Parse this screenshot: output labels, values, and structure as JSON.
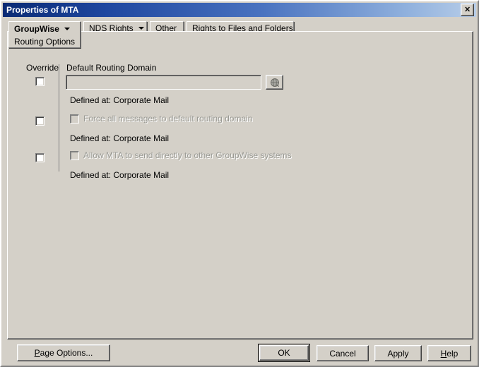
{
  "window": {
    "title": "Properties of MTA",
    "close_icon": "close-icon",
    "close_glyph": "✕"
  },
  "tabs": [
    {
      "label": "GroupWise",
      "sublabel": "Routing Options",
      "has_caret": true,
      "active": true
    },
    {
      "label": "NDS Rights",
      "has_caret": true,
      "active": false
    },
    {
      "label": "Other",
      "has_caret": false,
      "active": false
    },
    {
      "label": "Rights to Files and Folders",
      "has_caret": false,
      "active": false
    }
  ],
  "content": {
    "override_column_header": "Override",
    "field_label": "Default Routing Domain",
    "routing_domain_value": "",
    "routing_domain_placeholder": "",
    "browse_icon": "globe-icon",
    "defined_at_1": "Defined at: Corporate Mail",
    "option_1_label": "Force all messages to default routing domain",
    "defined_at_2": "Defined at: Corporate Mail",
    "option_2_label": "Allow MTA to send directly to other GroupWise systems",
    "defined_at_3": "Defined at: Corporate Mail"
  },
  "buttons": {
    "page_options_pre": "P",
    "page_options_rest": "age Options...",
    "ok": "OK",
    "cancel": "Cancel",
    "apply": "Apply",
    "help_pre": "H",
    "help_rest": "elp"
  },
  "colors": {
    "face": "#d4d0c8",
    "title_start": "#0a2a74",
    "title_end": "#b7cde8",
    "disabled_text": "#9a9a94"
  }
}
